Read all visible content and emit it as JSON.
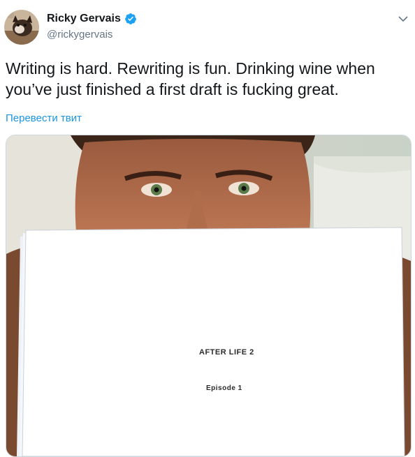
{
  "tweet": {
    "author": {
      "display_name": "Ricky Gervais",
      "handle": "@rickygervais",
      "verified": true,
      "avatar_icon": "avatar-dog-photo"
    },
    "text_line1": "Writing is hard. Rewriting is fun. Drinking wine when",
    "text_line2": "you’ve just finished a first draft is fucking great.",
    "translate_label": "Перевести твит",
    "menu_icon": "chevron-down-icon",
    "media": {
      "paper_title": "AFTER LIFE  2",
      "paper_subtitle": "Episode 1"
    }
  },
  "colors": {
    "text": "#14171a",
    "secondary": "#657786",
    "link": "#1b95e0",
    "verified": "#1da1f2",
    "border": "#ccd6dd"
  }
}
